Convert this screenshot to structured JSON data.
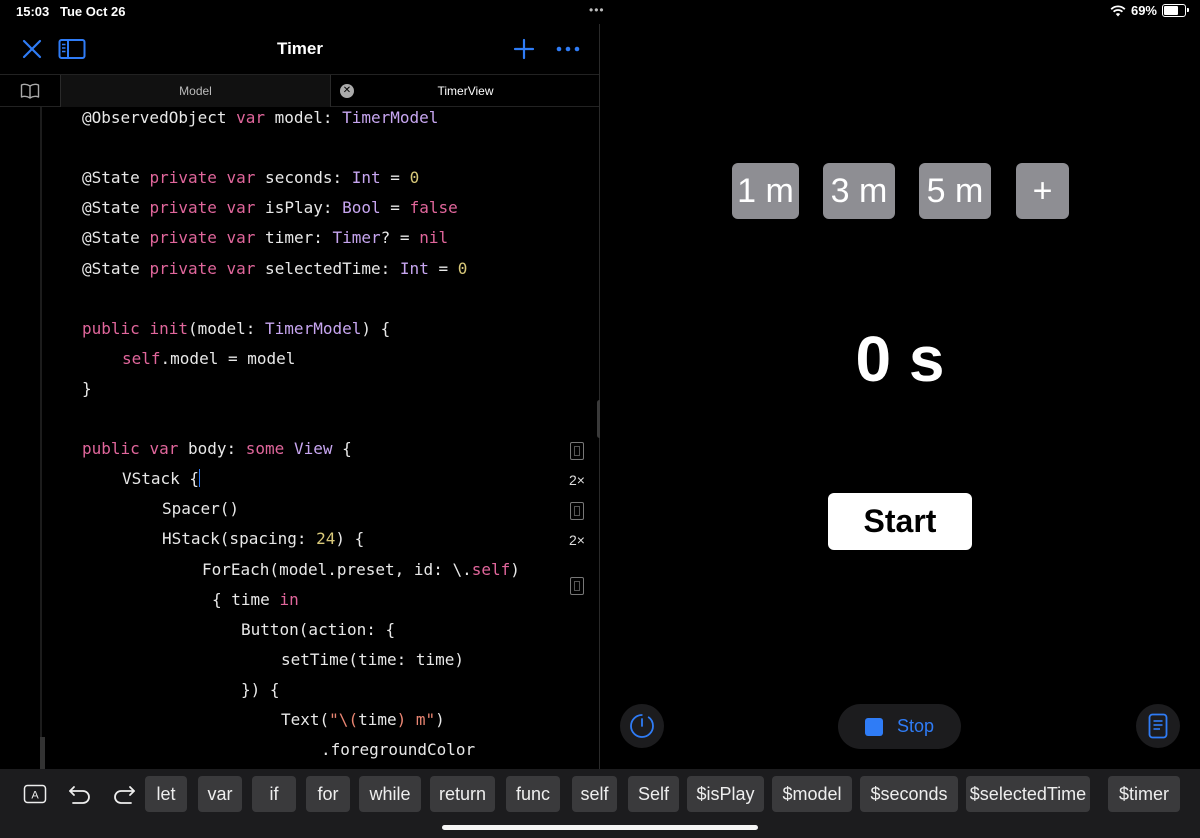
{
  "status_bar": {
    "time": "15:03",
    "date": "Tue Oct 26",
    "battery": "69%",
    "battery_level": 0.69
  },
  "editor": {
    "title": "Timer",
    "tabs": [
      {
        "label": "Model"
      },
      {
        "label": "TimerView"
      }
    ],
    "icons": {
      "close": "close-icon",
      "sidebar": "sidebar-icon",
      "add": "plus-icon",
      "more": "ellipsis-icon",
      "library": "book-icon",
      "tab_close": "x-circle-icon"
    },
    "inline_results": [
      "2×",
      "2×"
    ]
  },
  "preview": {
    "presets": [
      "1 m",
      "3 m",
      "5 m"
    ],
    "add_label": "+",
    "time_display": "0 s",
    "start_label": "Start",
    "stop_label": "Stop",
    "icons": {
      "left": "timer-icon",
      "right": "document-icon"
    }
  },
  "shortcut_bar": {
    "keys": [
      "let",
      "var",
      "if",
      "for",
      "while",
      "return",
      "func",
      "self",
      "Self",
      "$isPlay",
      "$model",
      "$seconds",
      "$selectedTime",
      "$timer"
    ],
    "icons": [
      "keyboard-a-icon",
      "undo-icon",
      "redo-icon"
    ]
  },
  "colors": {
    "accent": "#2f7cf6",
    "keyword": "#e0669b",
    "type": "#c7a6f0",
    "number": "#d9c97a",
    "string": "#e98572"
  }
}
